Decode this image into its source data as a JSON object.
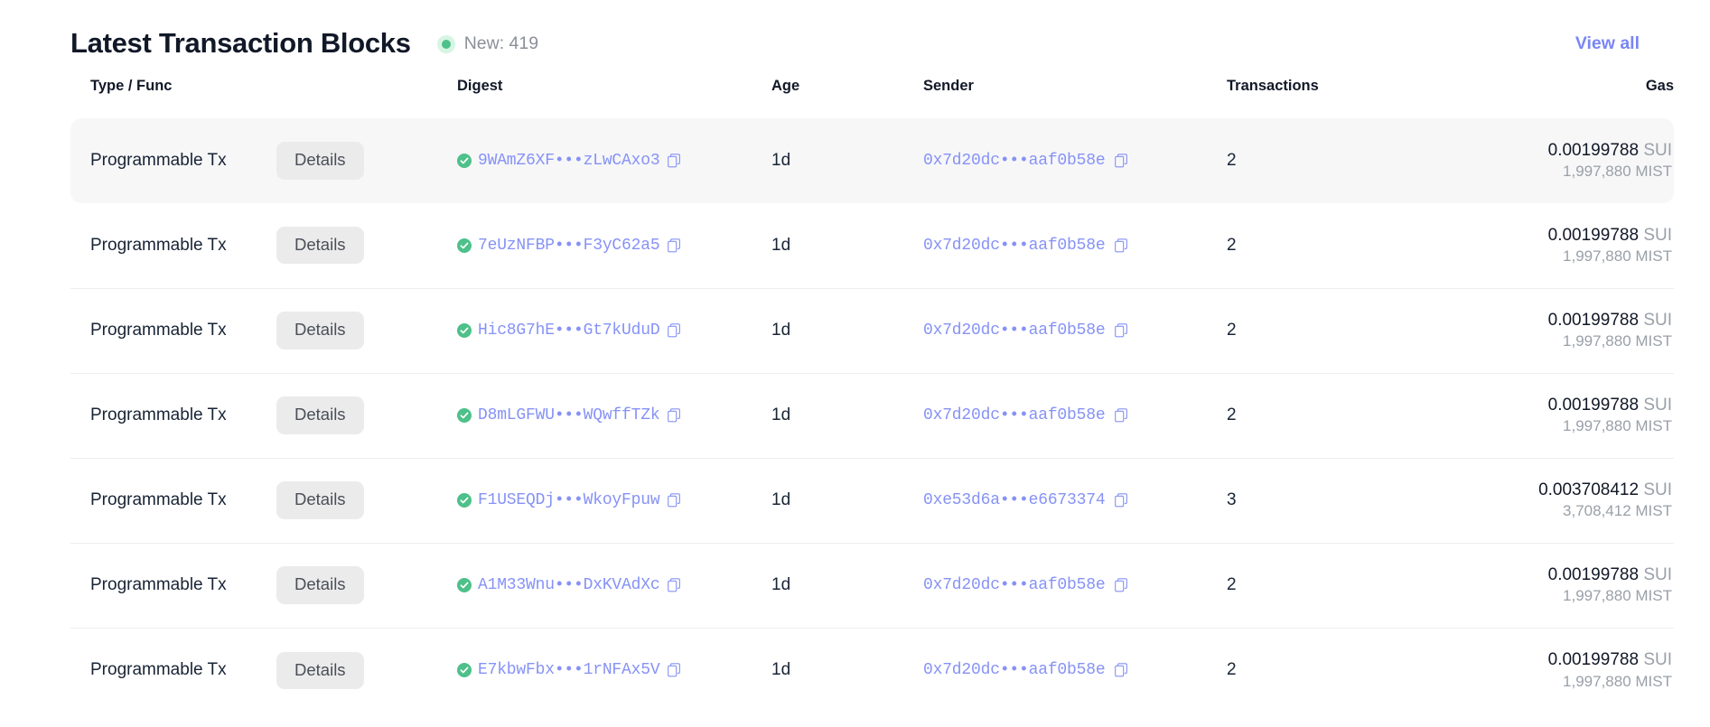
{
  "header": {
    "title": "Latest Transaction Blocks",
    "new_label": "New: 419",
    "status_dot": "green-dot-icon",
    "view_all_label": "View all"
  },
  "table": {
    "columns": [
      {
        "key": "type",
        "label": "Type / Func"
      },
      {
        "key": "digest",
        "label": "Digest"
      },
      {
        "key": "age",
        "label": "Age"
      },
      {
        "key": "sender",
        "label": "Sender"
      },
      {
        "key": "tx",
        "label": "Transactions"
      },
      {
        "key": "gas",
        "label": "Gas"
      }
    ],
    "details_label": "Details",
    "rows": [
      {
        "type": "Programmable Tx",
        "digest": "9WAmZ6XF•••zLwCAxo3",
        "age": "1d",
        "sender": "0x7d20dc•••aaf0b58e",
        "transactions": "2",
        "gas_amount": "0.00199788",
        "gas_unit": "SUI",
        "gas_mist": "1,997,880 MIST",
        "active": true
      },
      {
        "type": "Programmable Tx",
        "digest": "7eUzNFBP•••F3yC62a5",
        "age": "1d",
        "sender": "0x7d20dc•••aaf0b58e",
        "transactions": "2",
        "gas_amount": "0.00199788",
        "gas_unit": "SUI",
        "gas_mist": "1,997,880 MIST",
        "active": false
      },
      {
        "type": "Programmable Tx",
        "digest": "Hic8G7hE•••Gt7kUduD",
        "age": "1d",
        "sender": "0x7d20dc•••aaf0b58e",
        "transactions": "2",
        "gas_amount": "0.00199788",
        "gas_unit": "SUI",
        "gas_mist": "1,997,880 MIST",
        "active": false
      },
      {
        "type": "Programmable Tx",
        "digest": "D8mLGFWU•••WQwffTZk",
        "age": "1d",
        "sender": "0x7d20dc•••aaf0b58e",
        "transactions": "2",
        "gas_amount": "0.00199788",
        "gas_unit": "SUI",
        "gas_mist": "1,997,880 MIST",
        "active": false
      },
      {
        "type": "Programmable Tx",
        "digest": "F1USEQDj•••WkoyFpuw",
        "age": "1d",
        "sender": "0xe53d6a•••e6673374",
        "transactions": "3",
        "gas_amount": "0.003708412",
        "gas_unit": "SUI",
        "gas_mist": "3,708,412 MIST",
        "active": false
      },
      {
        "type": "Programmable Tx",
        "digest": "A1M33Wnu•••DxKVAdXc",
        "age": "1d",
        "sender": "0x7d20dc•••aaf0b58e",
        "transactions": "2",
        "gas_amount": "0.00199788",
        "gas_unit": "SUI",
        "gas_mist": "1,997,880 MIST",
        "active": false
      },
      {
        "type": "Programmable Tx",
        "digest": "E7kbwFbx•••1rNFAx5V",
        "age": "1d",
        "sender": "0x7d20dc•••aaf0b58e",
        "transactions": "2",
        "gas_amount": "0.00199788",
        "gas_unit": "SUI",
        "gas_mist": "1,997,880 MIST",
        "active": false
      }
    ]
  },
  "colors": {
    "link": "#7a86f5",
    "mono_link": "#8692f6",
    "success": "#4ec08a",
    "row_highlight": "#f7f7f8",
    "button_bg": "#ebebec"
  },
  "icons": {
    "success_check": "check-circle-icon",
    "copy": "copy-icon"
  }
}
